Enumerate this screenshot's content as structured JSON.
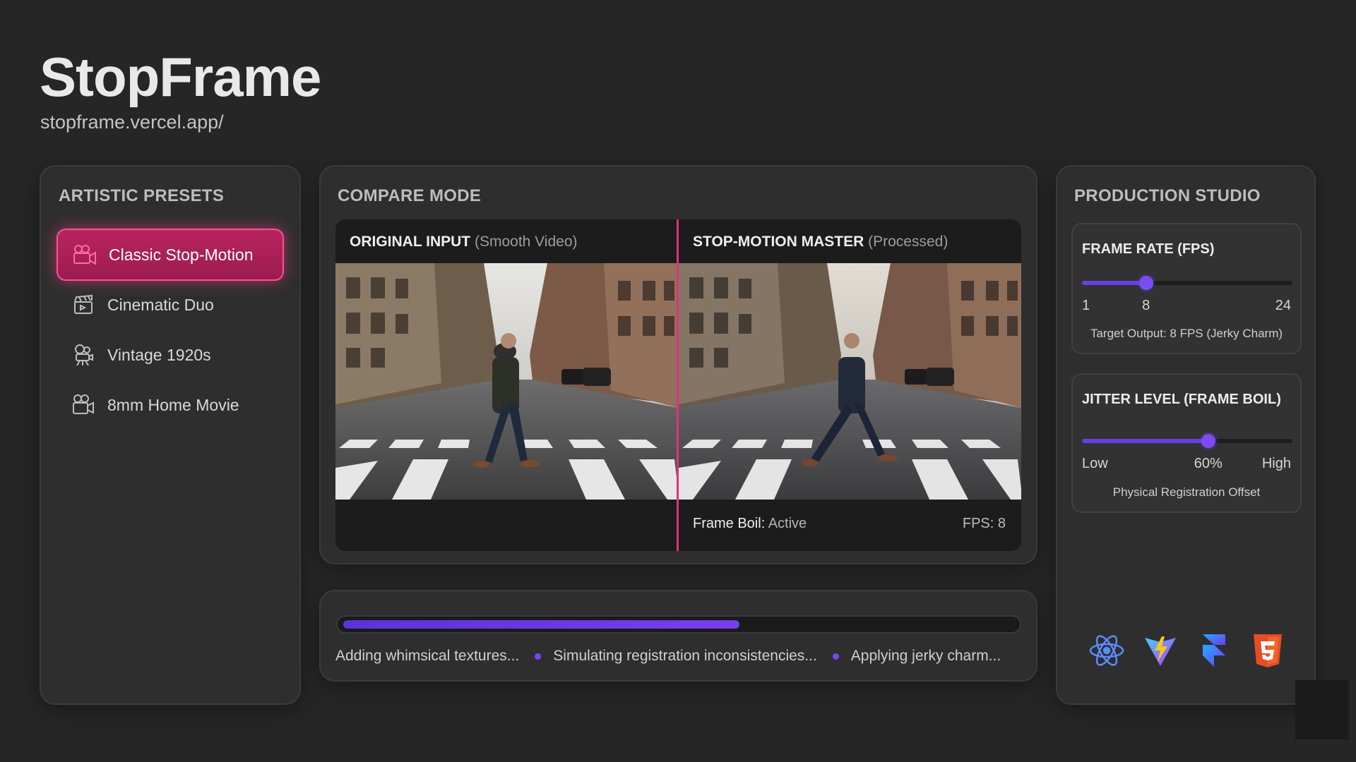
{
  "app": {
    "title": "StopFrame",
    "url": "stopframe.vercel.app/"
  },
  "presets": {
    "title": "ARTISTIC PRESETS",
    "items": [
      {
        "label": "Classic Stop-Motion",
        "icon": "video-camera-icon",
        "active": true
      },
      {
        "label": "Cinematic Duo",
        "icon": "clapperboard-icon",
        "active": false
      },
      {
        "label": "Vintage 1920s",
        "icon": "vintage-projector-icon",
        "active": false
      },
      {
        "label": "8mm Home Movie",
        "icon": "film-camera-icon",
        "active": false
      }
    ],
    "accent": "#ff4f94"
  },
  "compare": {
    "title": "COMPARE MODE",
    "original": {
      "label": "ORIGINAL INPUT",
      "sub": "(Smooth Video)"
    },
    "processed": {
      "label": "STOP-MOTION MASTER",
      "sub": "(Processed)"
    },
    "frame_boil_label": "Frame Boil:",
    "frame_boil_value": "Active",
    "fps_readout": "FPS: 8",
    "divider_color": "#e0337a"
  },
  "progress": {
    "value_percent": 59,
    "steps": [
      "Adding whimsical textures...",
      "Simulating registration inconsistencies...",
      "Applying jerky charm..."
    ],
    "color": "#6a3ee0"
  },
  "studio": {
    "title": "PRODUCTION STUDIO",
    "frame_rate": {
      "title": "FRAME RATE (FPS)",
      "min": 1,
      "max": 24,
      "value": 8,
      "min_label": "1",
      "value_label": "8",
      "max_label": "24",
      "note": "Target Output: 8 FPS (Jerky Charm)"
    },
    "jitter": {
      "title": "JITTER LEVEL (FRAME BOIL)",
      "value_percent": 60,
      "low_label": "Low",
      "value_label": "60%",
      "high_label": "High",
      "note": "Physical Registration Offset"
    },
    "logos": [
      "react-icon",
      "vite-icon",
      "framer-icon",
      "html5-icon"
    ]
  }
}
